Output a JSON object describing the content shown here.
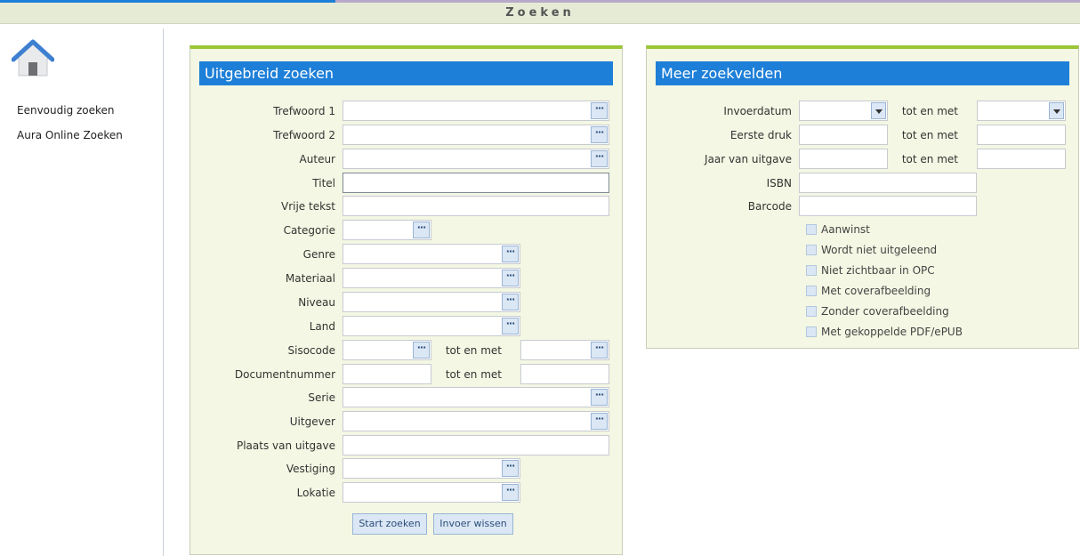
{
  "window": {
    "title": "Zoeken"
  },
  "sidebar": {
    "items": [
      {
        "label": "Eenvoudig zoeken"
      },
      {
        "label": "Aura Online Zoeken"
      }
    ]
  },
  "uitgebreid": {
    "title": "Uitgebreid zoeken",
    "fields": {
      "trefwoord1": "Trefwoord 1",
      "trefwoord2": "Trefwoord 2",
      "auteur": "Auteur",
      "titel": "Titel",
      "vrije_tekst": "Vrije tekst",
      "categorie": "Categorie",
      "genre": "Genre",
      "materiaal": "Materiaal",
      "niveau": "Niveau",
      "land": "Land",
      "sisocode": "Sisocode",
      "documentnummer": "Documentnummer",
      "serie": "Serie",
      "uitgever": "Uitgever",
      "plaats_van_uitgave": "Plaats van uitgave",
      "vestiging": "Vestiging",
      "lokatie": "Lokatie"
    },
    "tot_en_met": "tot en met",
    "lookup_glyph": "···",
    "buttons": {
      "start": "Start zoeken",
      "wissen": "Invoer wissen"
    }
  },
  "meer": {
    "title": "Meer zoekvelden",
    "fields": {
      "invoerdatum": "Invoerdatum",
      "eerste_druk": "Eerste druk",
      "jaar_van_uitgave": "Jaar van uitgave",
      "isbn": "ISBN",
      "barcode": "Barcode"
    },
    "tot_en_met": "tot en met",
    "checkboxes": [
      {
        "label": "Aanwinst"
      },
      {
        "label": "Wordt niet uitgeleend"
      },
      {
        "label": "Niet zichtbaar in OPC"
      },
      {
        "label": "Met coverafbeelding"
      },
      {
        "label": "Zonder coverafbeelding"
      },
      {
        "label": "Met gekoppelde PDF/ePUB"
      }
    ]
  },
  "colors": {
    "header_blue": "#1d7fd8",
    "panel_bg": "#f3f7e3",
    "accent_green": "#9bc637"
  }
}
